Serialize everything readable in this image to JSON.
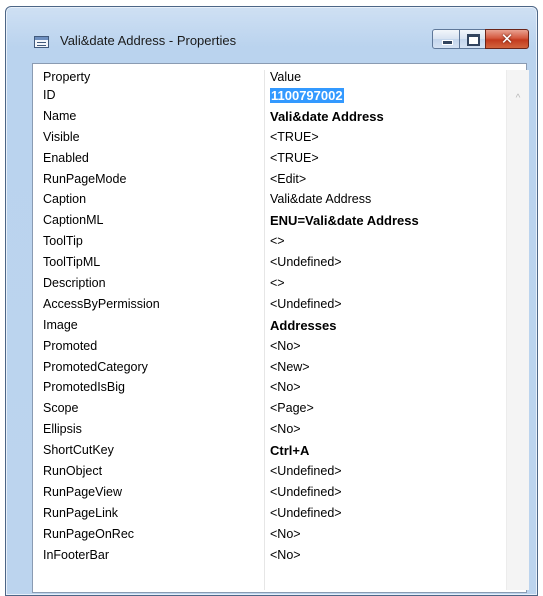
{
  "window": {
    "title": "Vali&date Address - Properties",
    "icon": "table-icon",
    "buttons": [
      "minimize-icon",
      "maximize-icon",
      "close-icon"
    ],
    "close_glyph": "✕"
  },
  "grid": {
    "columns": [
      "Property",
      "Value"
    ],
    "rows": [
      {
        "property": "ID",
        "value": "1100797002",
        "selected": true
      },
      {
        "property": "Name",
        "value": "Vali&date Address",
        "bold": true
      },
      {
        "property": "Visible",
        "value": "<TRUE>"
      },
      {
        "property": "Enabled",
        "value": "<TRUE>"
      },
      {
        "property": "RunPageMode",
        "value": "<Edit>"
      },
      {
        "property": "Caption",
        "value": "Vali&date Address"
      },
      {
        "property": "CaptionML",
        "value": "ENU=Vali&date Address",
        "bold": true
      },
      {
        "property": "ToolTip",
        "value": "<>"
      },
      {
        "property": "ToolTipML",
        "value": "<Undefined>"
      },
      {
        "property": "Description",
        "value": "<>"
      },
      {
        "property": "AccessByPermission",
        "value": "<Undefined>"
      },
      {
        "property": "Image",
        "value": "Addresses",
        "bold": true
      },
      {
        "property": "Promoted",
        "value": "<No>"
      },
      {
        "property": "PromotedCategory",
        "value": "<New>"
      },
      {
        "property": "PromotedIsBig",
        "value": "<No>"
      },
      {
        "property": "Scope",
        "value": "<Page>"
      },
      {
        "property": "Ellipsis",
        "value": "<No>"
      },
      {
        "property": "ShortCutKey",
        "value": "Ctrl+A",
        "bold": true
      },
      {
        "property": "RunObject",
        "value": "<Undefined>"
      },
      {
        "property": "RunPageView",
        "value": "<Undefined>"
      },
      {
        "property": "RunPageLink",
        "value": "<Undefined>"
      },
      {
        "property": "RunPageOnRec",
        "value": "<No>"
      },
      {
        "property": "InFooterBar",
        "value": "<No>"
      }
    ]
  },
  "scrollbar": {
    "up_glyph": "^"
  },
  "colors": {
    "selection": "#3399ff",
    "title_bar": "#bcd4ee",
    "close_button": "#c33a1e"
  }
}
